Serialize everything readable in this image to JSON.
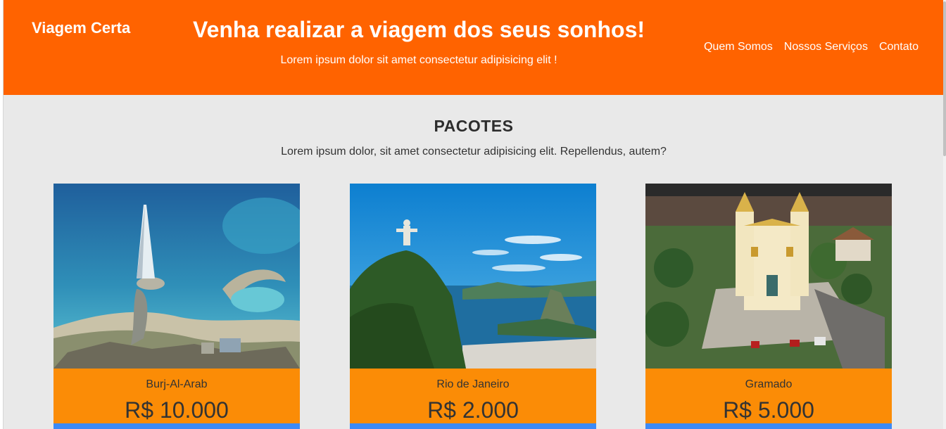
{
  "header": {
    "brand": "Viagem Certa",
    "hero_title": "Venha realizar a viagem dos seus sonhos!",
    "hero_subtitle": "Lorem ipsum dolor sit amet consectetur adipisicing elit !",
    "nav": [
      "Quem Somos",
      "Nossos Serviços",
      "Contato"
    ]
  },
  "packages": {
    "title": "PACOTES",
    "subtitle": "Lorem ipsum dolor, sit amet consectetur adipisicing elit. Repellendus, autem?",
    "items": [
      {
        "name": "Burj-Al-Arab",
        "price": "R$ 10.000"
      },
      {
        "name": "Rio de Janeiro",
        "price": "R$ 2.000"
      },
      {
        "name": "Gramado",
        "price": "R$ 5.000"
      }
    ]
  },
  "colors": {
    "header_bg": "#ff6300",
    "card_bg": "#fb8c06",
    "card_bar": "#3d8af7",
    "page_bg": "#e9e9e9"
  }
}
